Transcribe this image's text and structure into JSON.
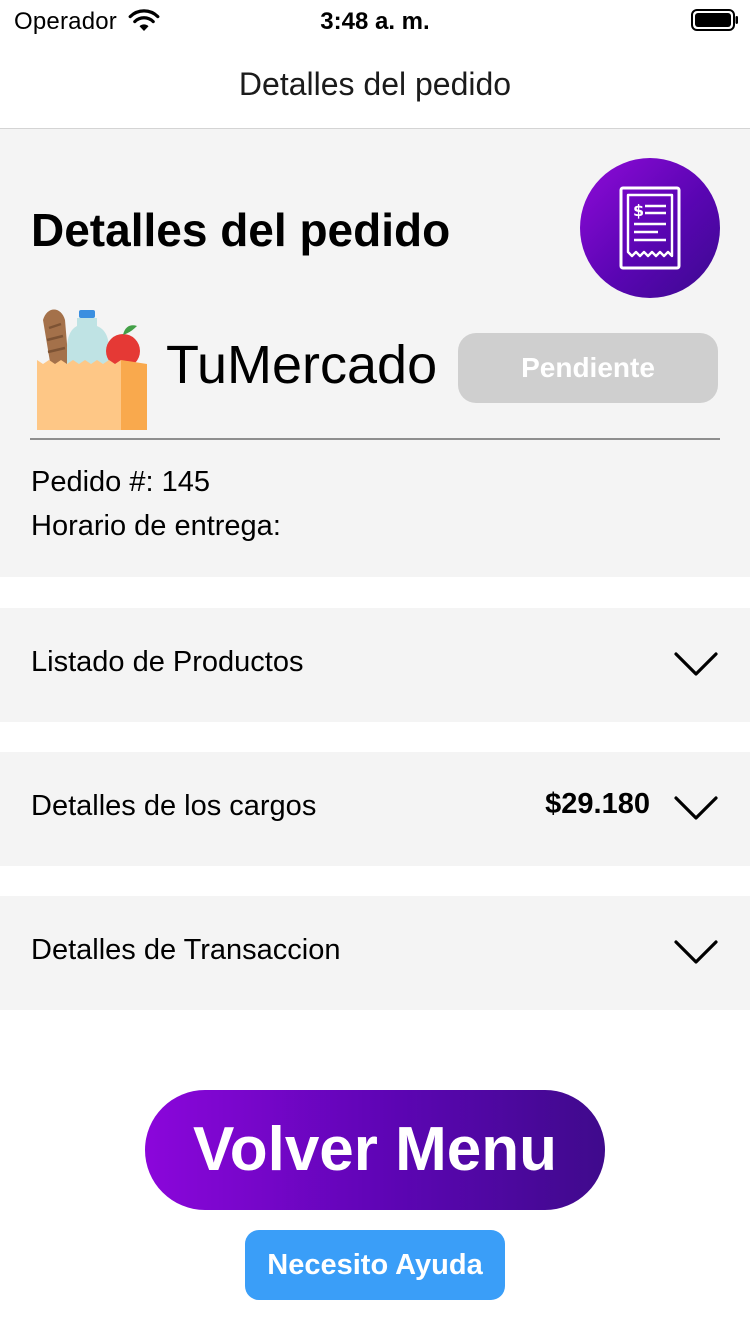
{
  "status_bar": {
    "carrier": "Operador",
    "time": "3:48 a. m."
  },
  "nav": {
    "title": "Detalles del pedido"
  },
  "order": {
    "title": "Detalles del pedido",
    "store_name": "TuMercado",
    "status_label": "Pendiente",
    "order_number_text": "Pedido #: 145",
    "delivery_text": "Horario de entrega:"
  },
  "sections": [
    {
      "label": "Listado de Productos",
      "amount": ""
    },
    {
      "label": "Detalles de los cargos",
      "amount": "$29.180"
    },
    {
      "label": "Detalles de Transaccion",
      "amount": ""
    }
  ],
  "actions": {
    "back_label": "Volver Menu",
    "help_label": "Necesito Ayuda"
  },
  "icons": {
    "wifi": "wifi-icon",
    "battery": "battery-icon",
    "receipt": "receipt-icon",
    "grocery_bag": "grocery-bag-icon",
    "chevron": "chevron-down-icon"
  },
  "colors": {
    "brand_gradient_start": "#8b06db",
    "brand_gradient_end": "#3f0a8c",
    "pending_badge": "#cfcfcf",
    "help_button": "#3a9ef8",
    "card_background": "#f4f4f4"
  }
}
